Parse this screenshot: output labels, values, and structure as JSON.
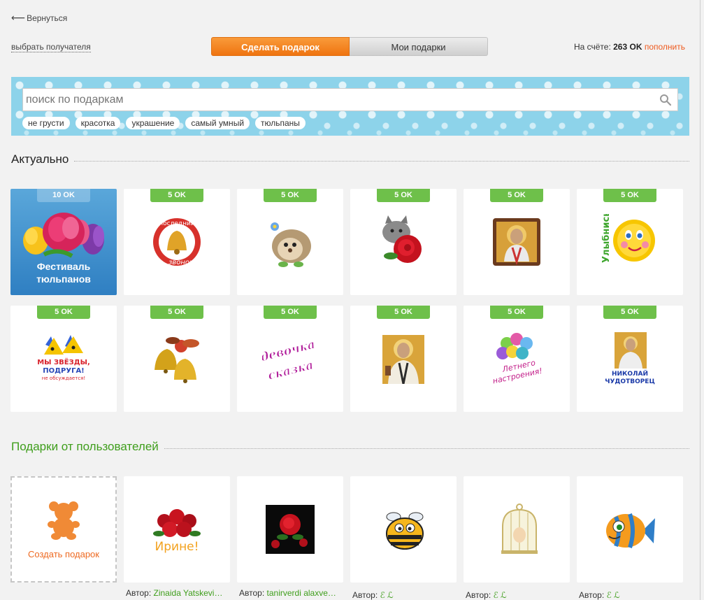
{
  "nav": {
    "back_label": "Вернуться"
  },
  "recipient_label": "выбрать получателя",
  "tabs": {
    "make_gift": "Сделать подарок",
    "my_gifts": "Мои подарки"
  },
  "balance": {
    "prefix": "На счёте:",
    "amount": "263 OK",
    "topup": "пополнить"
  },
  "search": {
    "placeholder": "поиск по подаркам",
    "tags": [
      "не грусти",
      "красотка",
      "украшение",
      "самый умный",
      "тюльпаны"
    ]
  },
  "sections": {
    "actual": "Актуально",
    "from_users": "Подарки от пользователей"
  },
  "featured": {
    "price": "10 OK",
    "title_line1": "Фестиваль",
    "title_line2": "тюльпанов"
  },
  "gifts": [
    {
      "price": "5 OK",
      "icon": "bell-icon"
    },
    {
      "price": "5 OK",
      "icon": "hedgehog-icon"
    },
    {
      "price": "5 OK",
      "icon": "kitten-rose-icon"
    },
    {
      "price": "5 OK",
      "icon": "icon-saint-icon"
    },
    {
      "price": "5 OK",
      "icon": "smile-sun-icon"
    },
    {
      "price": "5 OK",
      "icon": "stars-icon"
    },
    {
      "price": "5 OK",
      "icon": "bells-icon"
    },
    {
      "price": "5 OK",
      "icon": "girl-fairytale-icon"
    },
    {
      "price": "5 OK",
      "icon": "saint-nicholas-icon"
    },
    {
      "price": "5 OK",
      "icon": "balloons-icon"
    },
    {
      "price": "5 OK",
      "icon": "nikolai-icon"
    }
  ],
  "gift_texts": {
    "bell_top": "последний",
    "bell_bottom": "звонок",
    "smile": "Улыбнись",
    "stars_line1": "МЫ ЗВЁЗДЫ,",
    "stars_line2": "ПОДРУГА!",
    "stars_line3": "не обсуждается!",
    "girl_line1": "девочка",
    "girl_line2": "сказка",
    "balloons_line1": "Летнего",
    "balloons_line2": "настроения!",
    "nikolai_line1": "НИКОЛАЙ",
    "nikolai_line2": "ЧУДОТВОРЕЦ",
    "roses_name": "Ирине!"
  },
  "create": {
    "label": "Создать подарок"
  },
  "user_gifts": [
    {
      "author_prefix": "Автор:",
      "author": "Zinaida Yatskevi…",
      "icon": "roses-bouquet-icon"
    },
    {
      "author_prefix": "Автор:",
      "author": "tanirverdi alaxve…",
      "icon": "rose-black-icon"
    },
    {
      "author_prefix": "Автор:",
      "author": "ℰ ℒ",
      "icon": "bee-icon"
    },
    {
      "author_prefix": "Автор:",
      "author": "ℰ ℒ",
      "icon": "birdcage-icon"
    },
    {
      "author_prefix": "Автор:",
      "author": "ℰ ℒ",
      "icon": "fish-icon"
    }
  ],
  "colors": {
    "accent": "#ef7411",
    "price": "#6ec04a",
    "green_text": "#3f9e1c",
    "search_band": "#8dd3ea"
  }
}
